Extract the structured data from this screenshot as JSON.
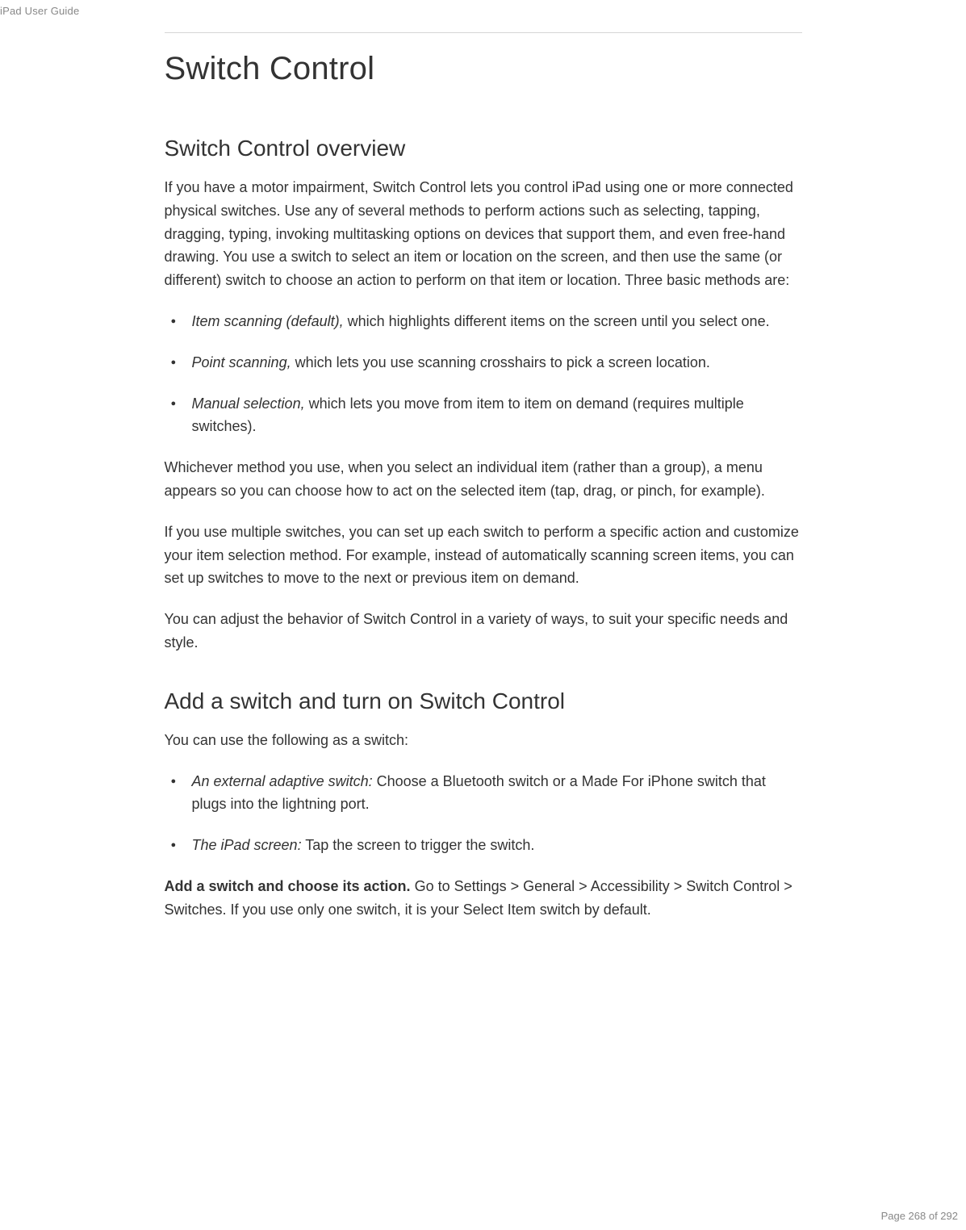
{
  "header": {
    "guide_label": "iPad User Guide"
  },
  "page": {
    "title": "Switch Control",
    "section1": {
      "heading": "Switch Control overview",
      "intro": "If you have a motor impairment, Switch Control lets you control iPad using one or more connected physical switches. Use any of several methods to perform actions such as selecting, tapping, dragging, typing, invoking multitasking options on devices that support them, and even free-hand drawing. You use a switch to select an item or location on the screen, and then use the same (or different) switch to choose an action to perform on that item or location. Three basic methods are:",
      "bullets": [
        {
          "term": "Item scanning (default),",
          "desc": " which highlights different items on the screen until you select one."
        },
        {
          "term": "Point scanning,",
          "desc": " which lets you use scanning crosshairs to pick a screen location."
        },
        {
          "term": "Manual selection,",
          "desc": " which lets you move from item to item on demand (requires multiple switches)."
        }
      ],
      "para2": "Whichever method you use, when you select an individual item (rather than a group), a menu appears so you can choose how to act on the selected item (tap, drag, or pinch, for example).",
      "para3": "If you use multiple switches, you can set up each switch to perform a specific action and customize your item selection method. For example, instead of automatically scanning screen items, you can set up switches to move to the next or previous item on demand.",
      "para4": "You can adjust the behavior of Switch Control in a variety of ways, to suit your specific needs and style."
    },
    "section2": {
      "heading": "Add a switch and turn on Switch Control",
      "intro": "You can use the following as a switch:",
      "bullets": [
        {
          "term": "An external adaptive switch:",
          "desc": " Choose a Bluetooth switch or a Made For iPhone switch that plugs into the lightning port."
        },
        {
          "term": "The iPad screen:",
          "desc": " Tap the screen to trigger the switch."
        }
      ],
      "para2_bold": "Add a switch and choose its action.",
      "para2_rest": " Go to Settings > General > Accessibility > Switch Control > Switches. If you use only one switch, it is your Select Item switch by default."
    }
  },
  "footer": {
    "page_number": "Page 268 of 292"
  }
}
